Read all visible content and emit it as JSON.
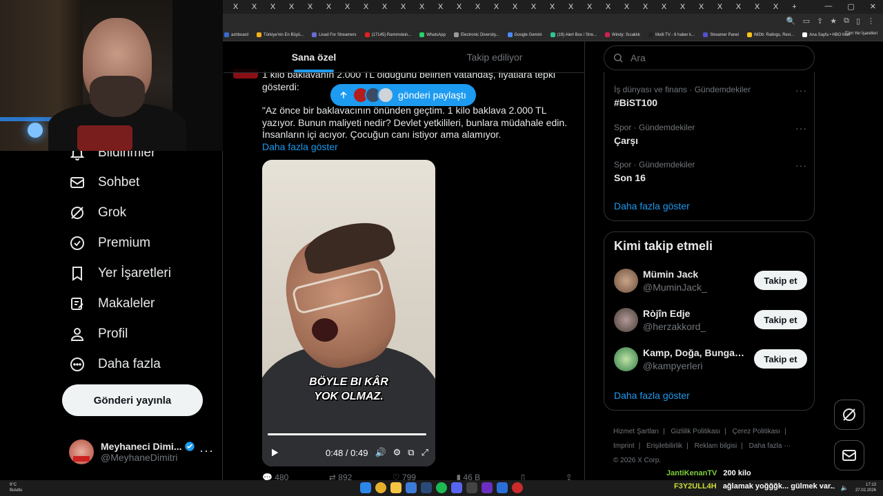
{
  "browser": {
    "tab_glyph": "X",
    "new_tab": "+",
    "window_controls": [
      "—",
      "▢",
      "✕"
    ],
    "bookmarks": [
      {
        "label": "ashboard",
        "color": "#3a6bd1"
      },
      {
        "label": "Türkiye'nin En Büyü...",
        "color": "#f2b01e"
      },
      {
        "label": "Livad For Streamers",
        "color": "#6b6bd6"
      },
      {
        "label": "(17145) Rammstein...",
        "color": "#e02020"
      },
      {
        "label": "WhatsApp",
        "color": "#25d366"
      },
      {
        "label": "Electronic Diversity...",
        "color": "#999999"
      },
      {
        "label": "Google Gemini",
        "color": "#4a8af4"
      },
      {
        "label": "(19) Alert Box / Stre...",
        "color": "#31c48d"
      },
      {
        "label": "Windy: Sıcaklık",
        "color": "#d02050"
      },
      {
        "label": "Multi TV - 6 haber k...",
        "color": "#222222"
      },
      {
        "label": "Streamer Panel",
        "color": "#5050d0"
      },
      {
        "label": "IMDb: Ratings, Revi...",
        "color": "#f5c518"
      },
      {
        "label": "Ana Sayfa • HBO Max",
        "color": "#ffffff"
      }
    ],
    "all_bookmarks": "Tüm Yer İşaretleri"
  },
  "leftnav": {
    "items": [
      {
        "label": "Bildirimler",
        "icon": "bell-icon"
      },
      {
        "label": "Sohbet",
        "icon": "mail-icon"
      },
      {
        "label": "Grok",
        "icon": "grok-icon"
      },
      {
        "label": "Premium",
        "icon": "verified-icon"
      },
      {
        "label": "Yer İşaretleri",
        "icon": "bookmark-icon"
      },
      {
        "label": "Makaleler",
        "icon": "article-icon"
      },
      {
        "label": "Profil",
        "icon": "user-icon"
      },
      {
        "label": "Daha fazla",
        "icon": "more-circle-icon"
      }
    ],
    "post_button": "Gönderi yayınla",
    "account": {
      "display_name": "Meyhaneci Dimi...",
      "handle": "@MeyhaneDimitri",
      "more": "···"
    }
  },
  "timeline": {
    "tabs": [
      "Sana özel",
      "Takip ediliyor"
    ],
    "new_posts_pill": "gönderi paylaştı",
    "tweet": {
      "intro": "1 kilo baklavanın 2.000 TL olduğunu belirten vatandaş, fiyatlara tepki gösterdi:",
      "quote": "\"Az önce bir baklavacının önünden geçtim. 1 kilo baklava 2.000 TL yazıyor. Bunun maliyeti nedir? Devlet yetkilileri, bunlara müdahale edin. İnsanların içi acıyor. Çocuğun canı istiyor ama alamıyor.",
      "show_more": "Daha fazla göster",
      "video": {
        "caption_line1": "BÖYLE BI KÂR",
        "caption_line2": "YOK OLMAZ.",
        "time": "0:48 / 0:49",
        "progress": 0.98
      },
      "actions": [
        "480",
        "892",
        "799",
        "46 B",
        "",
        ""
      ]
    }
  },
  "right": {
    "search_placeholder": "Ara",
    "trends": [
      {
        "meta": "İş dünyası ve finans · Gündemdekiler",
        "name": "#BiST100"
      },
      {
        "meta": "Spor · Gündemdekiler",
        "name": "Çarşı"
      },
      {
        "meta": "Spor · Gündemdekiler",
        "name": "Son 16"
      }
    ],
    "trends_more": "Daha fazla göster",
    "who_title": "Kimi takip etmeli",
    "who": [
      {
        "name": "Mümin Jack",
        "handle": "@MuminJack_",
        "button": "Takip et",
        "avatar_color": "#8a6a55"
      },
      {
        "name": "Ròjîn Edje",
        "handle": "@herzakkord_",
        "button": "Takip et",
        "avatar_color": "#6a5a58"
      },
      {
        "name": "Kamp, Doğa, Bungalo...",
        "handle": "@kampyerleri",
        "button": "Takip et",
        "avatar_color": "#3c8f5a"
      }
    ],
    "who_more": "Daha fazla göster",
    "footer": [
      "Hizmet Şartları",
      "|",
      "Gizlilik Politikası",
      "|",
      "Çerez Politikası",
      "|",
      "Imprint",
      "|",
      "Erişilebilirlik",
      "|",
      "Reklam bilgisi",
      "|",
      "Daha fazla ···",
      "© 2026 X Corp."
    ]
  },
  "stream_chat": [
    {
      "user": "JantiKenanTV",
      "msg": "200 kilo",
      "color": "#7fd13b"
    },
    {
      "user": "F3Y2ULL4H",
      "msg": "ağlamak yoğğğk... gülmek var.",
      "color": "#cddc39"
    }
  ],
  "taskbar": {
    "weather_temp": "9°C",
    "weather_desc": "Bulutlu",
    "time": "17:13",
    "date": "27.02.2026"
  }
}
